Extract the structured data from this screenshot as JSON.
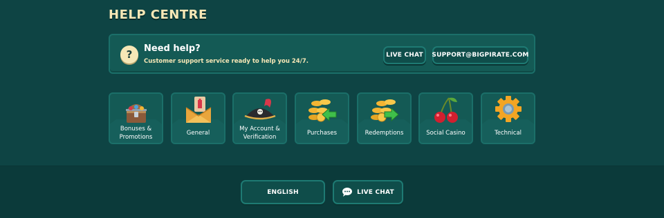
{
  "page": {
    "title": "HELP CENTRE"
  },
  "help": {
    "icon": "question-icon",
    "icon_glyph": "?",
    "heading": "Need help?",
    "subtext": "Customer support service ready to help you 24/7.",
    "live_chat_label": "LIVE CHAT",
    "email_label": "SUPPORT@BIGPIRATE.COM"
  },
  "categories": [
    {
      "label": "Bonuses &\nPromotions",
      "icon": "treasure-chest-icon"
    },
    {
      "label": "General",
      "icon": "envelope-icon"
    },
    {
      "label": "My Account &\nVerification",
      "icon": "pirate-hat-icon"
    },
    {
      "label": "Purchases",
      "icon": "coins-arrow-left-icon"
    },
    {
      "label": "Redemptions",
      "icon": "coins-arrow-right-icon"
    },
    {
      "label": "Social Casino",
      "icon": "cherries-icon"
    },
    {
      "label": "Technical",
      "icon": "gear-icon"
    }
  ],
  "footer": {
    "language_label": "ENGLISH",
    "live_chat_label": "LIVE CHAT",
    "live_chat_icon": "chat-bubble-icon"
  },
  "colors": {
    "background": "#0e4444",
    "card": "#145a55",
    "border": "#1b6f69",
    "title": "#f6e7b6"
  }
}
